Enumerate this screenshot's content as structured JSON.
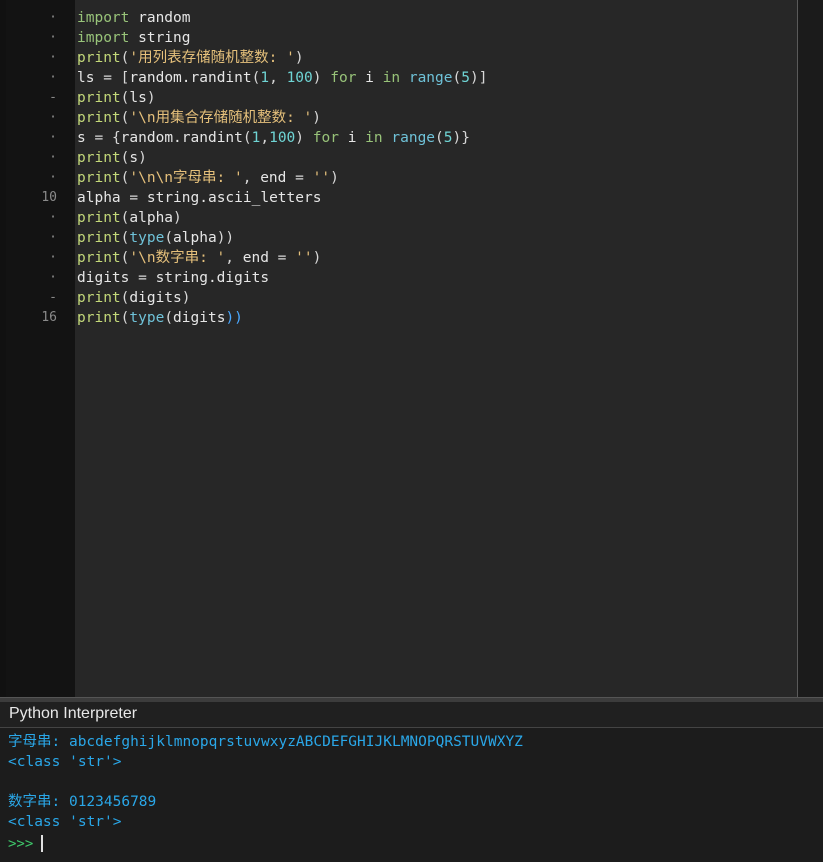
{
  "editor": {
    "gutter": [
      "·",
      "·",
      "·",
      "·",
      "-",
      "·",
      "·",
      "·",
      "·",
      "10",
      "·",
      "·",
      "·",
      "·",
      "-",
      "16"
    ],
    "lines": [
      [
        [
          "kw",
          "import"
        ],
        [
          "id",
          " random"
        ]
      ],
      [
        [
          "kw",
          "import"
        ],
        [
          "id",
          " string"
        ]
      ],
      [
        [
          "fn",
          "print"
        ],
        [
          "brk",
          "("
        ],
        [
          "str",
          "'用列表存储随机整数: '"
        ],
        [
          "brk",
          ")"
        ]
      ],
      [
        [
          "id",
          "ls "
        ],
        [
          "op",
          "="
        ],
        [
          "id",
          " "
        ],
        [
          "brk",
          "["
        ],
        [
          "id",
          "random.randint"
        ],
        [
          "brk",
          "("
        ],
        [
          "num",
          "1"
        ],
        [
          "op",
          ", "
        ],
        [
          "num",
          "100"
        ],
        [
          "brk",
          ")"
        ],
        [
          "id",
          " "
        ],
        [
          "kw",
          "for"
        ],
        [
          "id",
          " i "
        ],
        [
          "kw",
          "in"
        ],
        [
          "id",
          " "
        ],
        [
          "bi",
          "range"
        ],
        [
          "brk",
          "("
        ],
        [
          "num",
          "5"
        ],
        [
          "brk",
          ")]"
        ]
      ],
      [
        [
          "fn",
          "print"
        ],
        [
          "brk",
          "("
        ],
        [
          "id",
          "ls"
        ],
        [
          "brk",
          ")"
        ]
      ],
      [
        [
          "fn",
          "print"
        ],
        [
          "brk",
          "("
        ],
        [
          "str",
          "'\\n用集合存储随机整数: '"
        ],
        [
          "brk",
          ")"
        ]
      ],
      [
        [
          "id",
          "s "
        ],
        [
          "op",
          "="
        ],
        [
          "id",
          " "
        ],
        [
          "brk",
          "{"
        ],
        [
          "id",
          "random.randint"
        ],
        [
          "brk",
          "("
        ],
        [
          "num",
          "1"
        ],
        [
          "op",
          ","
        ],
        [
          "num",
          "100"
        ],
        [
          "brk",
          ")"
        ],
        [
          "id",
          " "
        ],
        [
          "kw",
          "for"
        ],
        [
          "id",
          " i "
        ],
        [
          "kw",
          "in"
        ],
        [
          "id",
          " "
        ],
        [
          "bi",
          "range"
        ],
        [
          "brk",
          "("
        ],
        [
          "num",
          "5"
        ],
        [
          "brk",
          ")}"
        ]
      ],
      [
        [
          "fn",
          "print"
        ],
        [
          "brk",
          "("
        ],
        [
          "id",
          "s"
        ],
        [
          "brk",
          ")"
        ]
      ],
      [
        [
          "fn",
          "print"
        ],
        [
          "brk",
          "("
        ],
        [
          "str",
          "'\\n\\n字母串: '"
        ],
        [
          "op",
          ", "
        ],
        [
          "id",
          "end "
        ],
        [
          "op",
          "="
        ],
        [
          "id",
          " "
        ],
        [
          "str",
          "''"
        ],
        [
          "brk",
          ")"
        ]
      ],
      [
        [
          "id",
          "alpha "
        ],
        [
          "op",
          "="
        ],
        [
          "id",
          " string.ascii_letters"
        ]
      ],
      [
        [
          "fn",
          "print"
        ],
        [
          "brk",
          "("
        ],
        [
          "id",
          "alpha"
        ],
        [
          "brk",
          ")"
        ]
      ],
      [
        [
          "fn",
          "print"
        ],
        [
          "brk",
          "("
        ],
        [
          "bi",
          "type"
        ],
        [
          "brk",
          "("
        ],
        [
          "id",
          "alpha"
        ],
        [
          "brk",
          "))"
        ]
      ],
      [
        [
          "fn",
          "print"
        ],
        [
          "brk",
          "("
        ],
        [
          "str",
          "'\\n数字串: '"
        ],
        [
          "op",
          ", "
        ],
        [
          "id",
          "end "
        ],
        [
          "op",
          "="
        ],
        [
          "id",
          " "
        ],
        [
          "str",
          "''"
        ],
        [
          "brk",
          ")"
        ]
      ],
      [
        [
          "id",
          "digits "
        ],
        [
          "op",
          "="
        ],
        [
          "id",
          " string.digits"
        ]
      ],
      [
        [
          "fn",
          "print"
        ],
        [
          "brk",
          "("
        ],
        [
          "id",
          "digits"
        ],
        [
          "brk",
          ")"
        ]
      ],
      [
        [
          "fn",
          "print"
        ],
        [
          "brk",
          "("
        ],
        [
          "bi",
          "type"
        ],
        [
          "brk",
          "("
        ],
        [
          "id",
          "digits"
        ],
        [
          "brk2",
          "))"
        ]
      ]
    ]
  },
  "interpreter": {
    "title": "Python Interpreter",
    "output": [
      "字母串: abcdefghijklmnopqrstuvwxyzABCDEFGHIJKLMNOPQRSTUVWXYZ",
      "<class 'str'>",
      "",
      "数字串: 0123456789",
      "<class 'str'>"
    ],
    "prompt": ">>> "
  },
  "colors": {
    "keyword": "#98c379",
    "string": "#e5c07b",
    "number": "#6fd5d5",
    "builtin": "#6fc2d8",
    "output": "#2aa7e8",
    "prompt": "#3ec76a"
  }
}
